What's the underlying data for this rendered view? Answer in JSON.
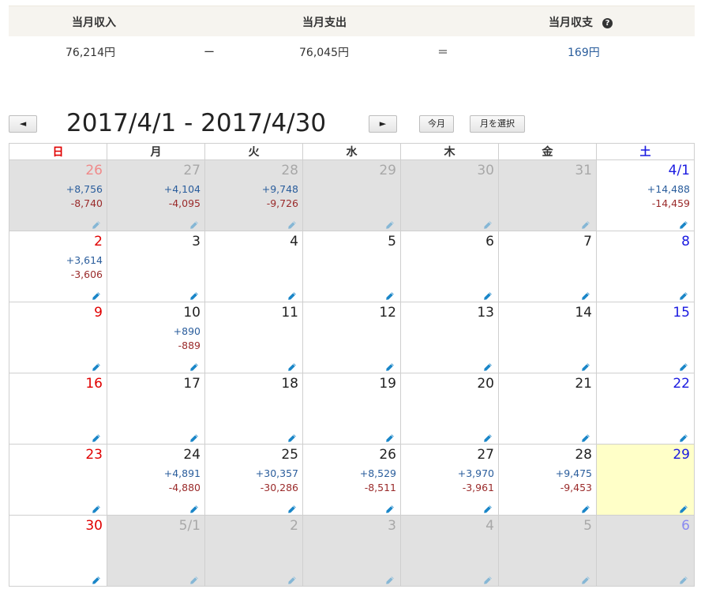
{
  "summary": {
    "income_label": "当月収入",
    "expense_label": "当月支出",
    "balance_label": "当月収支",
    "help_icon": "?",
    "income_value": "76,214円",
    "minus_sign": "ー",
    "expense_value": "76,045円",
    "equals_sign": "＝",
    "balance_value": "169円"
  },
  "toolbar": {
    "prev_label": "◄",
    "next_label": "►",
    "period": "2017/4/1 - 2017/4/30",
    "this_month_label": "今月",
    "select_month_label": "月を選択"
  },
  "calendar": {
    "weekdays": [
      "日",
      "月",
      "火",
      "水",
      "木",
      "金",
      "土"
    ],
    "weeks": [
      [
        {
          "day": "26",
          "income": "+8,756",
          "expense": "-8,740"
        },
        {
          "day": "27",
          "income": "+4,104",
          "expense": "-4,095"
        },
        {
          "day": "28",
          "income": "+9,748",
          "expense": "-9,726"
        },
        {
          "day": "29",
          "income": "",
          "expense": ""
        },
        {
          "day": "30",
          "income": "",
          "expense": ""
        },
        {
          "day": "31",
          "income": "",
          "expense": ""
        },
        {
          "day": "4/1",
          "income": "+14,488",
          "expense": "-14,459"
        }
      ],
      [
        {
          "day": "2",
          "income": "+3,614",
          "expense": "-3,606"
        },
        {
          "day": "3",
          "income": "",
          "expense": ""
        },
        {
          "day": "4",
          "income": "",
          "expense": ""
        },
        {
          "day": "5",
          "income": "",
          "expense": ""
        },
        {
          "day": "6",
          "income": "",
          "expense": ""
        },
        {
          "day": "7",
          "income": "",
          "expense": ""
        },
        {
          "day": "8",
          "income": "",
          "expense": ""
        }
      ],
      [
        {
          "day": "9",
          "income": "",
          "expense": ""
        },
        {
          "day": "10",
          "income": "+890",
          "expense": "-889"
        },
        {
          "day": "11",
          "income": "",
          "expense": ""
        },
        {
          "day": "12",
          "income": "",
          "expense": ""
        },
        {
          "day": "13",
          "income": "",
          "expense": ""
        },
        {
          "day": "14",
          "income": "",
          "expense": ""
        },
        {
          "day": "15",
          "income": "",
          "expense": ""
        }
      ],
      [
        {
          "day": "16",
          "income": "",
          "expense": ""
        },
        {
          "day": "17",
          "income": "",
          "expense": ""
        },
        {
          "day": "18",
          "income": "",
          "expense": ""
        },
        {
          "day": "19",
          "income": "",
          "expense": ""
        },
        {
          "day": "20",
          "income": "",
          "expense": ""
        },
        {
          "day": "21",
          "income": "",
          "expense": ""
        },
        {
          "day": "22",
          "income": "",
          "expense": ""
        }
      ],
      [
        {
          "day": "23",
          "income": "",
          "expense": ""
        },
        {
          "day": "24",
          "income": "+4,891",
          "expense": "-4,880"
        },
        {
          "day": "25",
          "income": "+30,357",
          "expense": "-30,286"
        },
        {
          "day": "26",
          "income": "+8,529",
          "expense": "-8,511"
        },
        {
          "day": "27",
          "income": "+3,970",
          "expense": "-3,961"
        },
        {
          "day": "28",
          "income": "+9,475",
          "expense": "-9,453"
        },
        {
          "day": "29",
          "income": "",
          "expense": ""
        }
      ],
      [
        {
          "day": "30",
          "income": "",
          "expense": ""
        },
        {
          "day": "5/1",
          "income": "",
          "expense": ""
        },
        {
          "day": "2",
          "income": "",
          "expense": ""
        },
        {
          "day": "3",
          "income": "",
          "expense": ""
        },
        {
          "day": "4",
          "income": "",
          "expense": ""
        },
        {
          "day": "5",
          "income": "",
          "expense": ""
        },
        {
          "day": "6",
          "income": "",
          "expense": ""
        }
      ]
    ]
  },
  "icons": {
    "edit": "pencil-icon",
    "help": "question-circle-icon"
  },
  "colors": {
    "sunday": "#e00000",
    "saturday": "#1a1ae0",
    "income": "#2a5d9c",
    "expense": "#9a2a2a",
    "other_month_bg": "#e1e1e1",
    "today_bg": "#ffffc8",
    "edit_icon": "#1a86c8"
  }
}
